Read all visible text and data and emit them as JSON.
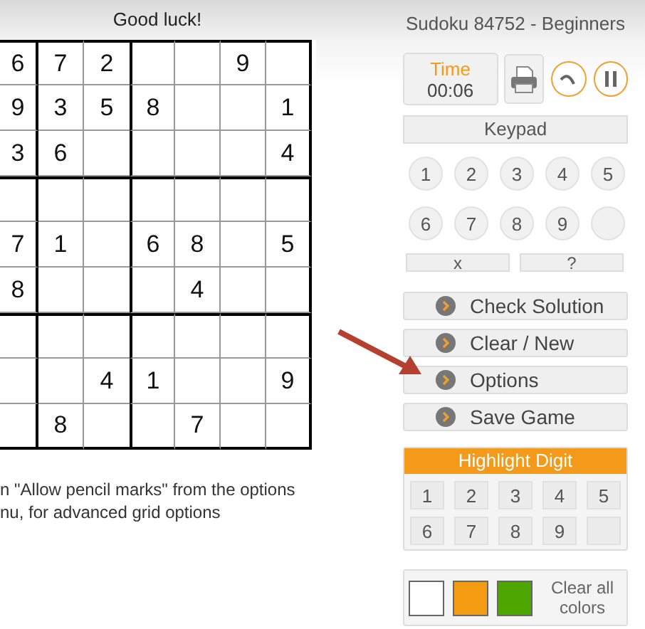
{
  "header": {
    "message": "Good luck!",
    "title": "Sudoku 84752 - Beginners"
  },
  "grid": {
    "rows": [
      [
        "6",
        "7",
        "2",
        "",
        "",
        "9",
        ""
      ],
      [
        "9",
        "3",
        "5",
        "8",
        "",
        "",
        "1"
      ],
      [
        "3",
        "6",
        "",
        "",
        "",
        "",
        "4"
      ],
      [
        "",
        "",
        "",
        "",
        "",
        "",
        ""
      ],
      [
        "7",
        "1",
        "",
        "6",
        "8",
        "",
        "5"
      ],
      [
        "8",
        "",
        "",
        "",
        "4",
        "",
        ""
      ],
      [
        "",
        "",
        "",
        "",
        "",
        "",
        ""
      ],
      [
        "",
        "",
        "4",
        "1",
        "",
        "",
        "9"
      ],
      [
        "",
        "8",
        "",
        "",
        "7",
        "",
        ""
      ]
    ]
  },
  "hint_lines": [
    "n \"Allow pencil marks\" from the options",
    "nu, for advanced grid options"
  ],
  "timer": {
    "label": "Time",
    "value": "00:06"
  },
  "keypad": {
    "title": "Keypad",
    "keys": [
      {
        "kind": "digit",
        "label": "1"
      },
      {
        "kind": "digit",
        "label": "2"
      },
      {
        "kind": "digit",
        "label": "3"
      },
      {
        "kind": "digit",
        "label": "4"
      },
      {
        "kind": "digit",
        "label": "5"
      },
      {
        "kind": "digit",
        "label": "6"
      },
      {
        "kind": "digit",
        "label": "7"
      },
      {
        "kind": "digit",
        "label": "8"
      },
      {
        "kind": "digit",
        "label": "9"
      },
      {
        "kind": "blank"
      }
    ],
    "extra_keys": [
      "x",
      "?"
    ]
  },
  "actions": [
    "Check Solution",
    "Clear / New",
    "Options",
    "Save Game"
  ],
  "highlight": {
    "title": "Highlight Digit",
    "keys": [
      {
        "kind": "digit",
        "label": "1"
      },
      {
        "kind": "digit",
        "label": "2"
      },
      {
        "kind": "digit",
        "label": "3"
      },
      {
        "kind": "digit",
        "label": "4"
      },
      {
        "kind": "digit",
        "label": "5"
      },
      {
        "kind": "digit",
        "label": "6"
      },
      {
        "kind": "digit",
        "label": "7"
      },
      {
        "kind": "digit",
        "label": "8"
      },
      {
        "kind": "digit",
        "label": "9"
      },
      {
        "kind": "blank"
      }
    ]
  },
  "colors": {
    "swatches": [
      {
        "color": "#ffffff"
      },
      {
        "color": "#f39c12"
      },
      {
        "color": "#4ea600"
      }
    ],
    "clear_label": "Clear all colors"
  }
}
